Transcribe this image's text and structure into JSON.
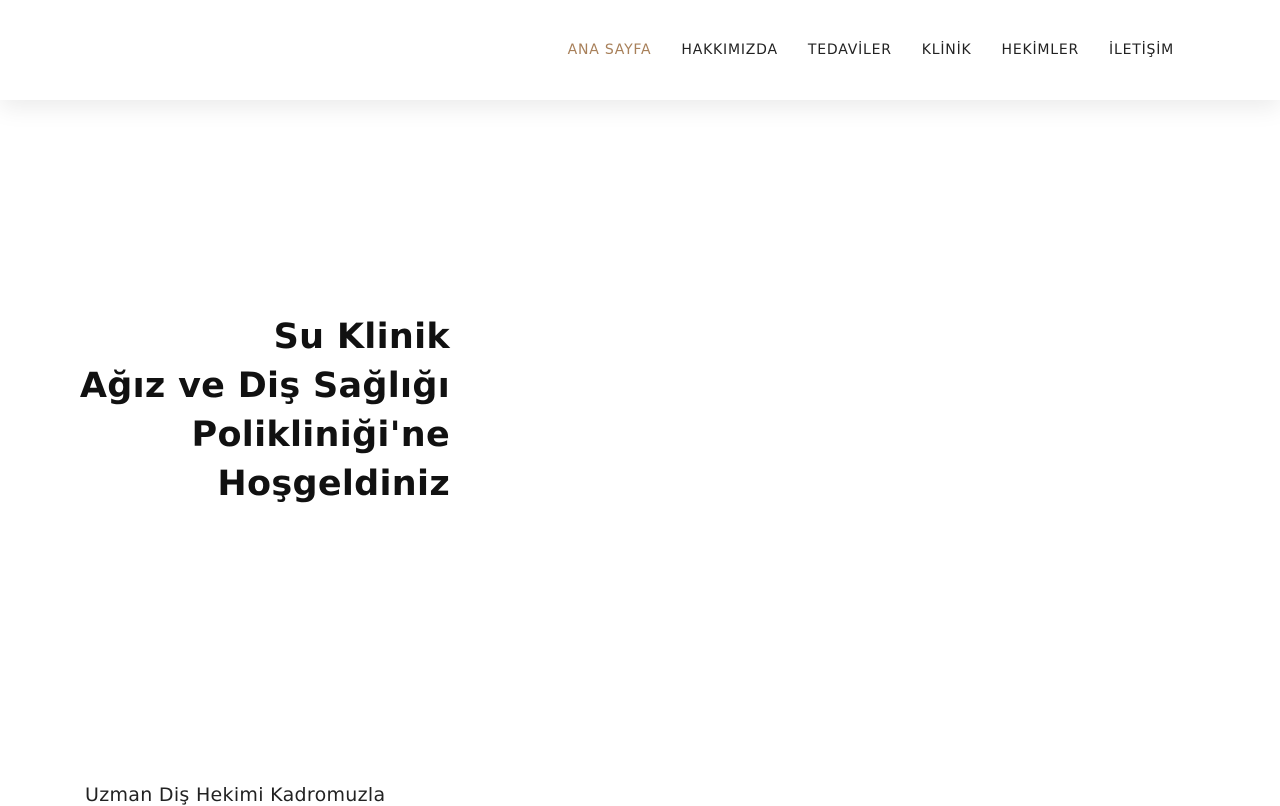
{
  "nav": {
    "items": [
      {
        "label": "ANA SAYFA",
        "active": true
      },
      {
        "label": "HAKKIMIZDA",
        "active": false
      },
      {
        "label": "TEDAVİLER",
        "active": false
      },
      {
        "label": "KLİNİK",
        "active": false
      },
      {
        "label": "HEKİMLER",
        "active": false
      },
      {
        "label": "İLETİŞİM",
        "active": false
      }
    ],
    "active_color": "#a8805a"
  },
  "hero": {
    "title_lines": [
      "Su Klinik",
      "Ağız ve Diş Sağlığı",
      "Polikliniği'ne",
      "Hoşgeldiniz"
    ]
  },
  "section": {
    "subtitle": "Uzman Diş Hekimi Kadromuzla"
  }
}
